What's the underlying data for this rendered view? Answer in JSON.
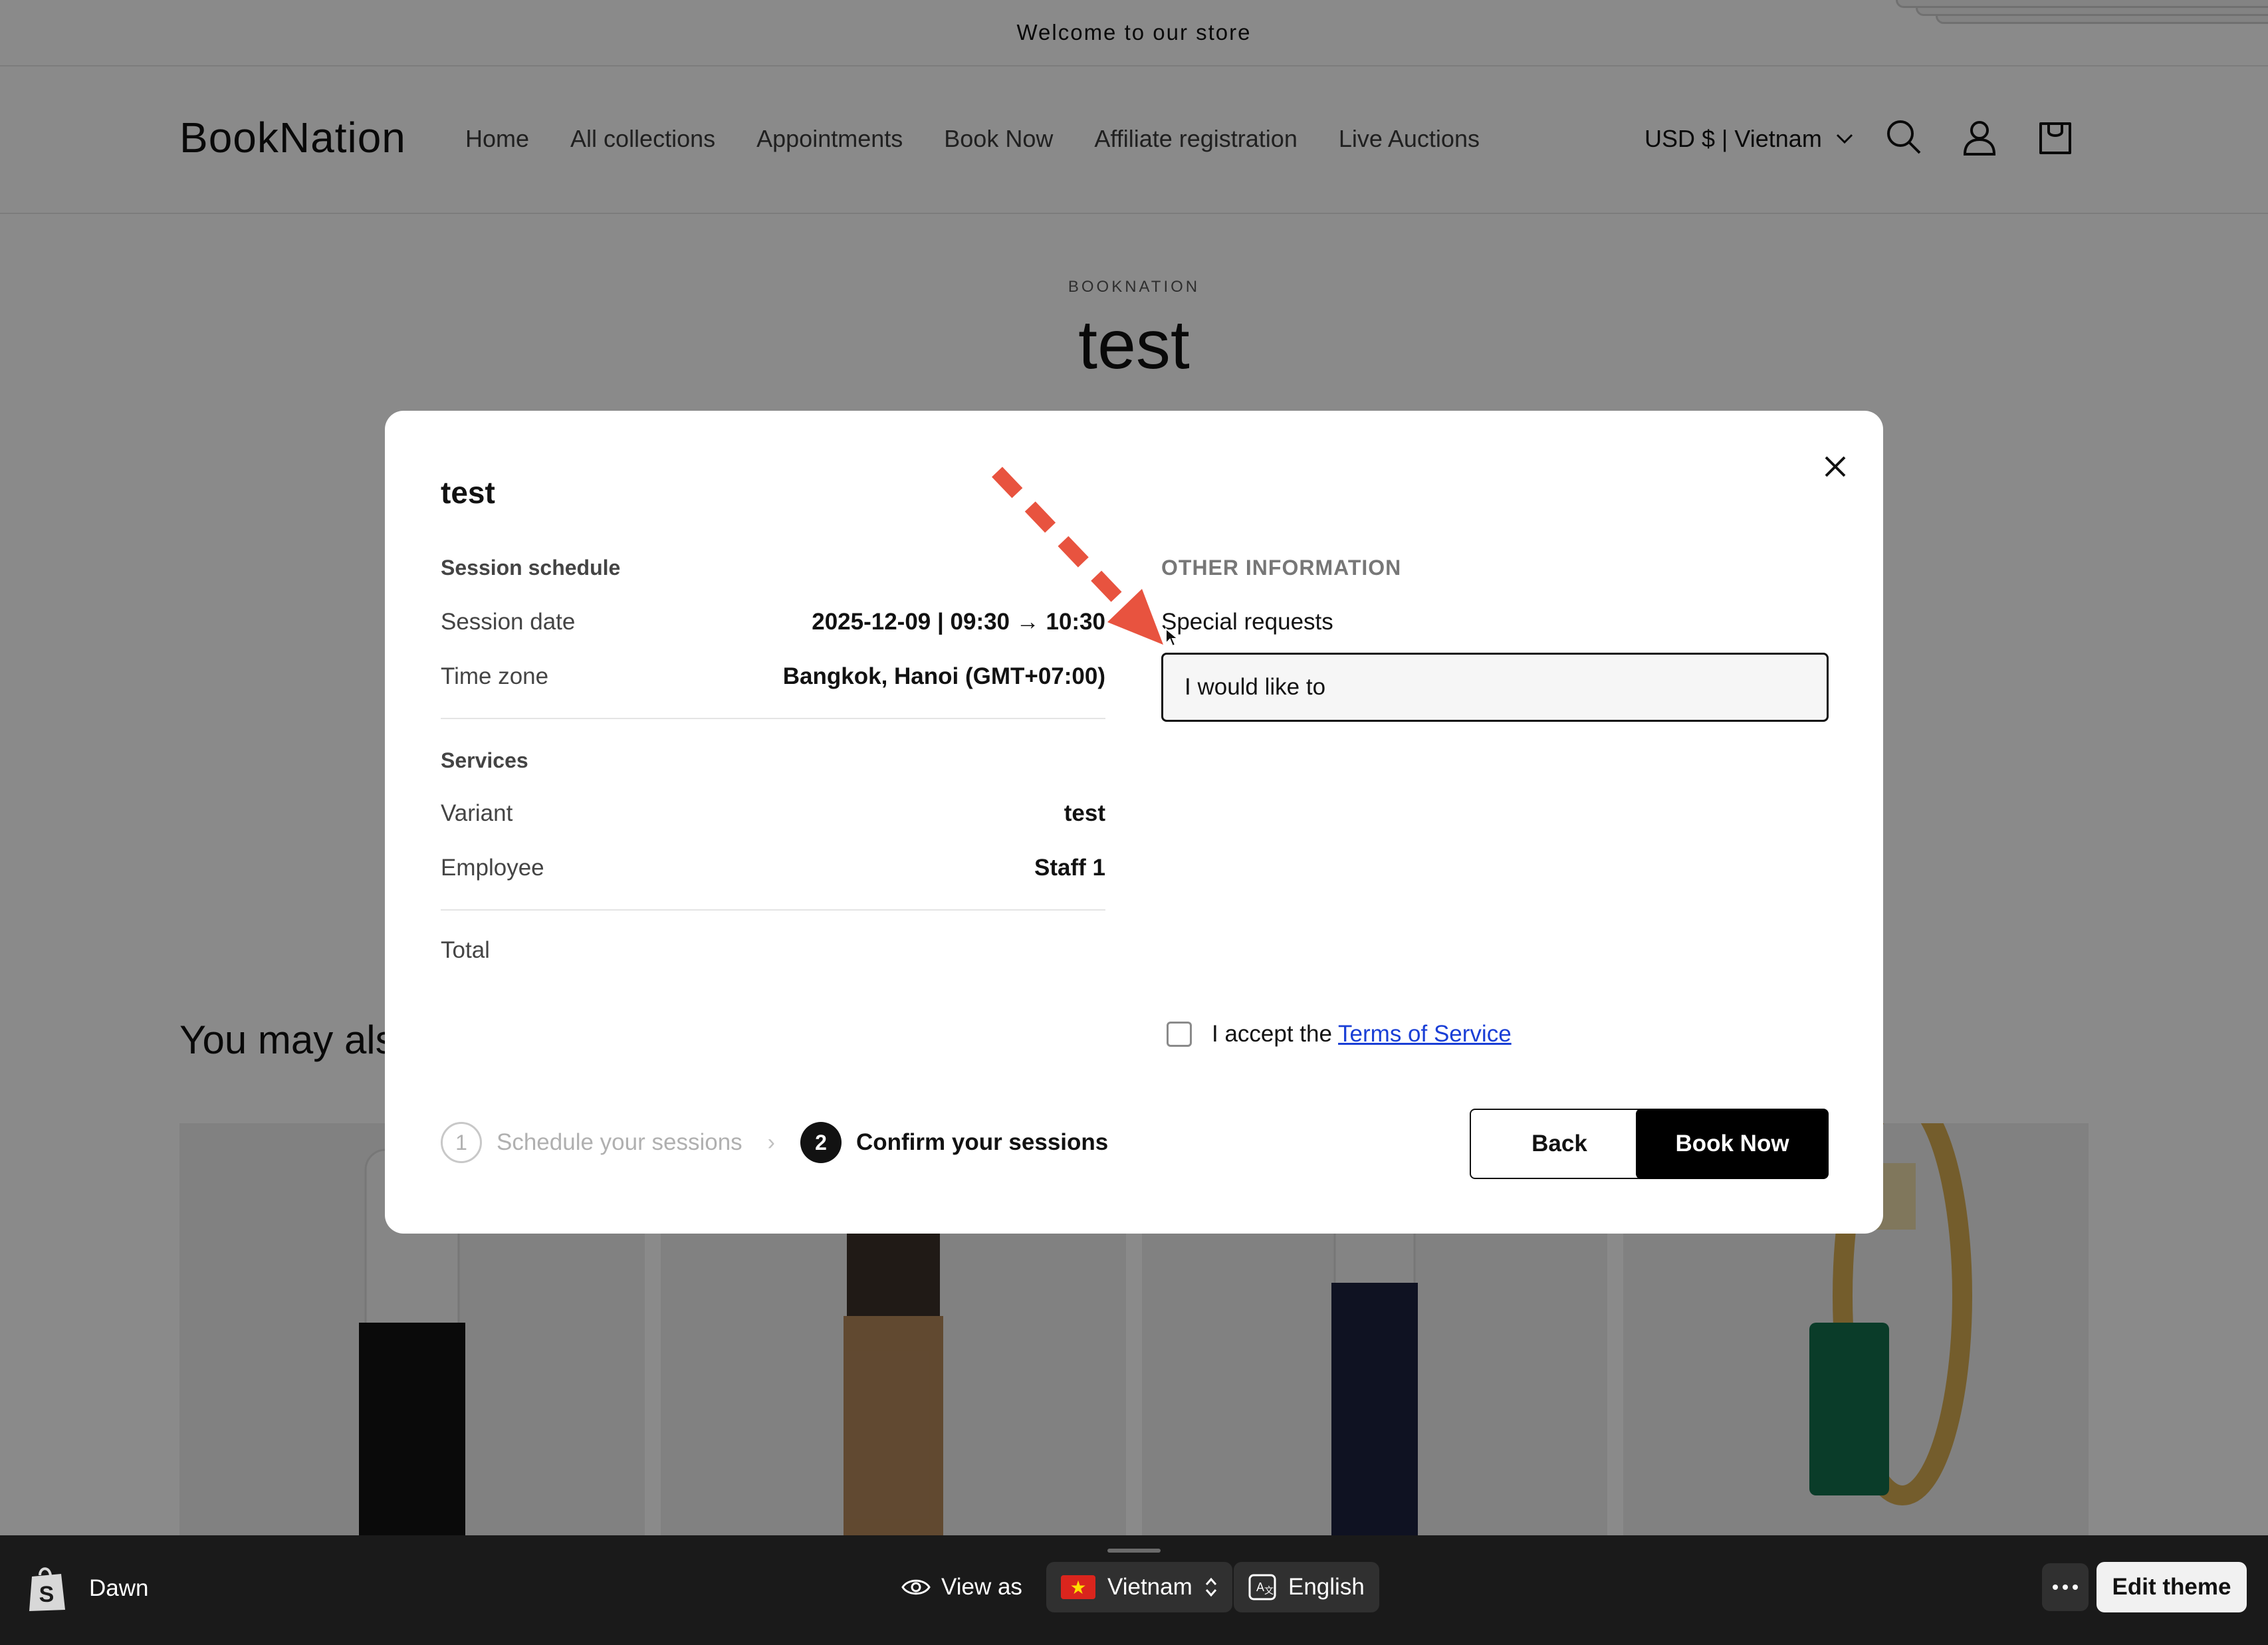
{
  "announcement": {
    "text": "Welcome to our store"
  },
  "header": {
    "logo": "BookNation",
    "nav": [
      "Home",
      "All collections",
      "Appointments",
      "Book Now",
      "Affiliate registration",
      "Live Auctions"
    ],
    "currency": "USD $ | Vietnam"
  },
  "product": {
    "vendor": "BOOKNATION",
    "title": "test"
  },
  "recommendations": {
    "heading": "You may als"
  },
  "modal": {
    "title": "test",
    "schedule": {
      "heading": "Session schedule",
      "date_label": "Session date",
      "date_value": "2025-12-09 | 09:30 → 10:30",
      "tz_label": "Time zone",
      "tz_value": "Bangkok, Hanoi (GMT+07:00)"
    },
    "services": {
      "heading": "Services",
      "variant_label": "Variant",
      "variant_value": "test",
      "employee_label": "Employee",
      "employee_value": "Staff 1"
    },
    "total_label": "Total",
    "other": {
      "heading": "OTHER INFORMATION",
      "special_label": "Special requests",
      "special_value": "I would like to"
    },
    "terms": {
      "prefix": "I accept the",
      "link": "Terms of Service"
    },
    "steps": [
      {
        "number": "1",
        "label": "Schedule your sessions",
        "state": "inactive"
      },
      {
        "number": "2",
        "label": "Confirm your sessions",
        "state": "active"
      }
    ],
    "back_label": "Back",
    "book_label": "Book Now"
  },
  "preview_bar": {
    "theme": "Dawn",
    "view_as": "View as",
    "country": "Vietnam",
    "language": "English",
    "edit_theme": "Edit theme"
  },
  "colors": {
    "accent": "#000000",
    "link": "#1a3fd6",
    "annotation_arrow": "#e8533f"
  }
}
